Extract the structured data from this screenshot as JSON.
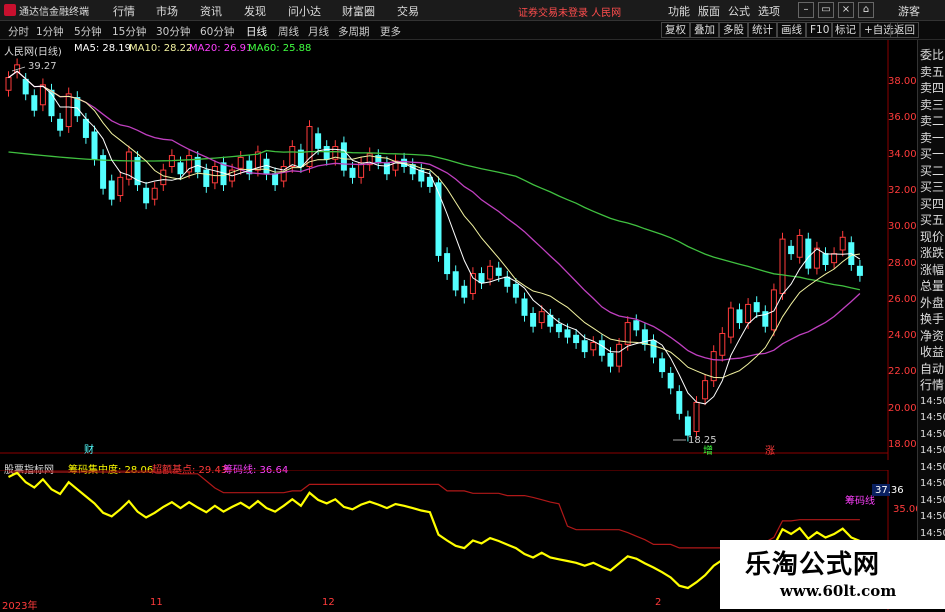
{
  "titlebar": {
    "app_name": "通达信金融终端",
    "menus": [
      "行情",
      "市场",
      "资讯",
      "发现",
      "问小达",
      "财富圈",
      "交易"
    ],
    "notice": "证券交易未登录  人民网",
    "right_menus": [
      "功能",
      "版面",
      "公式",
      "选项"
    ],
    "guest": "游客"
  },
  "toolbar": {
    "periods": [
      "分时",
      "1分钟",
      "5分钟",
      "15分钟",
      "30分钟",
      "60分钟",
      "日线",
      "周线",
      "月线",
      "多周期",
      "更多"
    ],
    "active_period": "日线",
    "buttons": [
      "复权",
      "叠加",
      "多股",
      "统计",
      "画线",
      "F10",
      "标记",
      "+自选",
      "返回"
    ]
  },
  "chart": {
    "stock_title": "人民网(日线)",
    "ma_labels": [
      {
        "name": "MA5: 28.19",
        "color": "#ffffff"
      },
      {
        "name": "MA10: 28.22",
        "color": "#f2f2a0"
      },
      {
        "name": "MA20: 26.91",
        "color": "#ff40ff"
      },
      {
        "name": "MA60: 25.88",
        "color": "#40ff40"
      }
    ],
    "high_marker": "39.27",
    "low_marker": "18.25",
    "price_ticks": [
      "38.00",
      "36.00",
      "34.00",
      "32.00",
      "30.00",
      "28.00",
      "26.00",
      "24.00",
      "22.00",
      "20.00",
      "18.00"
    ],
    "markers": [
      "财",
      "增",
      "涨"
    ]
  },
  "indicator": {
    "name": "股票指标网",
    "label1": "筹码集中度: 28.06",
    "label2": "超额基点: 29.43",
    "label3": "筹码线: 36.64",
    "right_tag": "筹码线",
    "value_box": "37.36",
    "tick": "35.00"
  },
  "time_axis": [
    "2023年",
    "11",
    "12",
    "2"
  ],
  "right_panel": {
    "items": [
      "委比",
      "卖五",
      "卖四",
      "卖三",
      "卖二",
      "卖一",
      "买一",
      "买二",
      "买三",
      "买四",
      "买五",
      "现价",
      "涨跌",
      "涨幅",
      "总量",
      "外盘",
      "换手",
      "净资",
      "收益",
      "自动",
      "行情",
      "14:50",
      "14:50",
      "14:50",
      "14:50",
      "14:50",
      "14:50",
      "14:50",
      "14:50",
      "14:50",
      "14:50",
      "14:50",
      "14:50",
      "14:50"
    ]
  },
  "watermark": {
    "title": "乐淘公式网",
    "url": "www.60lt.com"
  },
  "colors": {
    "up": "#ff3b3b",
    "down": "#54ffff",
    "ma5": "#ffffff",
    "ma10": "#f2f2a0",
    "ma20": "#c040c0",
    "ma60": "#40c040",
    "chip": "#ffff00"
  }
}
